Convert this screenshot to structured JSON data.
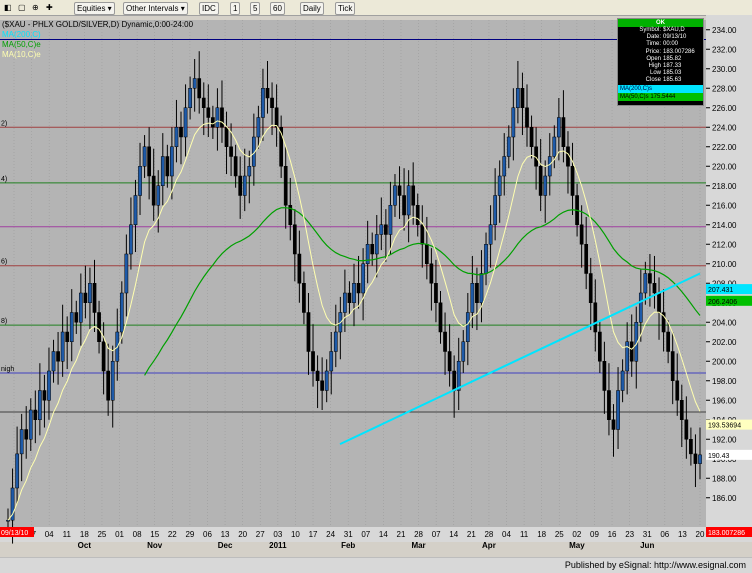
{
  "toolbar": {
    "items": [
      {
        "name": "equities-dropdown",
        "label": "Equities ▾"
      },
      {
        "name": "other-intervals-dropdown",
        "label": "Other Intervals ▾"
      },
      {
        "name": "interval-idc",
        "label": "IDC"
      },
      {
        "name": "interval-1",
        "label": "1"
      },
      {
        "name": "interval-5",
        "label": "5"
      },
      {
        "name": "interval-60",
        "label": "60"
      },
      {
        "name": "interval-daily",
        "label": "Daily"
      },
      {
        "name": "interval-tick",
        "label": "Tick"
      }
    ]
  },
  "chart_data": {
    "type": "candlestick",
    "title": "($XAU - PHLX GOLD/SILVER,D) Dynamic,0:00-24:00",
    "legend": [
      "MA(200,C)",
      "MA(50,C)e",
      "MA(10,C)e"
    ],
    "ylim": [
      183,
      235
    ],
    "yticks": [
      186,
      188,
      190,
      192,
      194,
      196,
      198,
      200,
      202,
      204,
      206,
      208,
      210,
      212,
      214,
      216,
      218,
      220,
      222,
      224,
      226,
      228,
      230,
      232,
      234
    ],
    "x_day_ticks": [
      "20",
      "27",
      "04",
      "11",
      "18",
      "25",
      "01",
      "08",
      "15",
      "22",
      "29",
      "06",
      "13",
      "20",
      "27",
      "03",
      "10",
      "17",
      "24",
      "31",
      "07",
      "14",
      "21",
      "28",
      "07",
      "14",
      "21",
      "28",
      "04",
      "11",
      "18",
      "25",
      "02",
      "09",
      "16",
      "23",
      "31",
      "06",
      "13",
      "20"
    ],
    "x_month_labels": [
      "Oct",
      "Nov",
      "Dec",
      "2011",
      "Feb",
      "Mar",
      "Apr",
      "May",
      "Jun"
    ],
    "start_date_label": "09/13/10",
    "end_date_label": "09/13/10",
    "horizontal_levels": [
      {
        "value": 233.0,
        "color": "#000080",
        "label": ""
      },
      {
        "value": 224.0,
        "color": "#a04040",
        "label": "2)"
      },
      {
        "value": 218.3,
        "color": "#208020",
        "label": "4)"
      },
      {
        "value": 213.8,
        "color": "#a040a0",
        "label": ""
      },
      {
        "value": 209.8,
        "color": "#a04040",
        "label": "6)"
      },
      {
        "value": 203.7,
        "color": "#208020",
        "label": "8)"
      },
      {
        "value": 198.8,
        "color": "#4040c0",
        "label": "nigh"
      },
      {
        "value": 194.8,
        "color": "#404040",
        "label": ""
      }
    ],
    "ma200": {
      "start_date": "2011-02-14",
      "start": 191.5,
      "end_date": "2011-06-17",
      "end": 209.0
    },
    "series_closes": [
      183.7,
      187,
      190.5,
      193,
      192,
      195,
      194,
      197,
      196,
      199,
      201,
      200,
      203,
      202,
      205,
      204,
      207,
      206,
      208,
      205,
      202,
      199,
      196,
      200,
      203,
      207,
      211,
      214,
      217,
      220,
      222,
      219,
      216,
      218,
      221,
      219,
      222,
      224,
      223,
      226,
      228,
      229,
      227,
      226,
      225,
      224,
      226,
      224,
      222,
      221,
      219,
      217,
      219,
      220,
      223,
      225,
      228,
      227,
      226,
      224,
      220,
      216,
      214,
      211,
      208,
      205,
      201,
      199,
      198,
      197,
      199,
      201,
      203,
      205,
      207,
      206,
      208,
      207,
      210,
      212,
      211,
      213,
      214,
      213,
      216,
      218,
      217,
      215,
      218,
      216,
      214,
      212,
      210,
      208,
      206,
      203,
      201,
      199,
      197,
      200,
      202,
      205,
      208,
      206,
      209,
      212,
      214,
      217,
      219,
      221,
      223,
      226,
      228,
      226,
      224,
      222,
      220,
      217,
      219,
      221,
      223,
      225,
      222,
      220,
      217,
      214,
      212,
      209,
      206,
      203,
      200,
      197,
      194,
      193,
      197,
      199,
      202,
      200,
      204,
      207,
      209,
      208,
      207,
      205,
      203,
      201,
      198,
      196,
      194,
      192,
      190.5,
      189.5,
      190.4
    ],
    "last_price": 183.007286,
    "price_labels": [
      {
        "text": "207.431",
        "color": "#00e5ff"
      },
      {
        "text": "206.2406",
        "color": "#00c000"
      },
      {
        "text": "193.53694",
        "color": "#ffffc0"
      },
      {
        "text": "190.43",
        "color": "#ffffff"
      },
      {
        "text": "183.007286",
        "color": "#ff0000"
      }
    ]
  },
  "infobox": {
    "ok_label": "OK",
    "rows": [
      {
        "k": "Symbol:",
        "v": "$XAU,D"
      },
      {
        "k": "Date:",
        "v": "09/13/10"
      },
      {
        "k": "Time:",
        "v": "00:00"
      },
      {
        "k": "Price:",
        "v": "183.007286"
      },
      {
        "k": "Open",
        "v": "185.82"
      },
      {
        "k": "High",
        "v": "187.33"
      },
      {
        "k": "Low",
        "v": "185.03"
      },
      {
        "k": "Close",
        "v": "185.63"
      }
    ],
    "ma200": "MA(200,C)s",
    "ma50": "MA(50,C)s 175.5444"
  },
  "colors": {
    "bg": "#b4b4b4",
    "grid": "#9c9c9c",
    "ma200": "#00e5ff",
    "ma50": "#00a000",
    "ma10": "#ffffb0",
    "bar": "#000000",
    "bar_blue": "#1e5aa8"
  },
  "footer": {
    "text": "Published by eSignal: http://www.esignal.com"
  }
}
